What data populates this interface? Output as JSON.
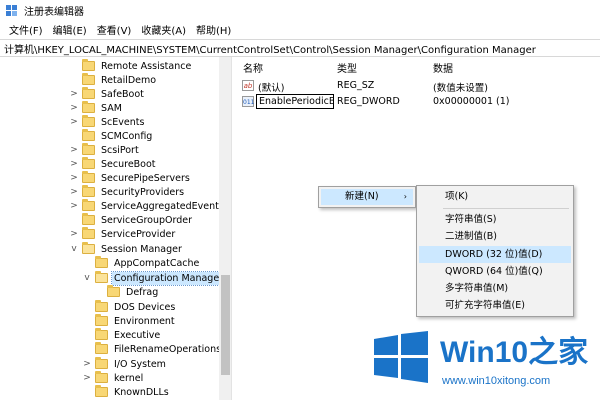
{
  "window": {
    "title": "注册表编辑器",
    "brand_color": "#3a7fd5"
  },
  "menu": [
    "文件(F)",
    "编辑(E)",
    "查看(V)",
    "收藏夹(A)",
    "帮助(H)"
  ],
  "address": "计算机\\HKEY_LOCAL_MACHINE\\SYSTEM\\CurrentControlSet\\Control\\Session Manager\\Configuration Manager",
  "tree": [
    {
      "label": "Remote Assistance",
      "expander": ""
    },
    {
      "label": "RetailDemo",
      "expander": ""
    },
    {
      "label": "SafeBoot",
      "expander": ">"
    },
    {
      "label": "SAM",
      "expander": ">"
    },
    {
      "label": "ScEvents",
      "expander": ">"
    },
    {
      "label": "SCMConfig",
      "expander": ""
    },
    {
      "label": "ScsiPort",
      "expander": ">"
    },
    {
      "label": "SecureBoot",
      "expander": ">"
    },
    {
      "label": "SecurePipeServers",
      "expander": ">"
    },
    {
      "label": "SecurityProviders",
      "expander": ">"
    },
    {
      "label": "ServiceAggregatedEvents",
      "expander": ">"
    },
    {
      "label": "ServiceGroupOrder",
      "expander": ""
    },
    {
      "label": "ServiceProvider",
      "expander": ">"
    },
    {
      "label": "Session Manager",
      "expander": "v"
    },
    {
      "label": "AppCompatCache",
      "expander": ""
    },
    {
      "label": "Configuration Manager",
      "expander": "v"
    },
    {
      "label": "Defrag",
      "expander": ""
    },
    {
      "label": "DOS Devices",
      "expander": ""
    },
    {
      "label": "Environment",
      "expander": ""
    },
    {
      "label": "Executive",
      "expander": ""
    },
    {
      "label": "FileRenameOperations",
      "expander": ""
    },
    {
      "label": "I/O System",
      "expander": ">"
    },
    {
      "label": "kernel",
      "expander": ">"
    },
    {
      "label": "KnownDLLs",
      "expander": ""
    }
  ],
  "list": {
    "headers": {
      "name": "名称",
      "type": "类型",
      "data": "数据"
    },
    "rows": [
      {
        "icon": "ab",
        "name": "(默认)",
        "type": "REG_SZ",
        "data": "(数值未设置)"
      },
      {
        "icon": "011",
        "name": "EnablePeriodicB...",
        "type": "REG_DWORD",
        "data": "0x00000001 (1)"
      }
    ]
  },
  "context_menu": {
    "new_label": "新建(N)",
    "arrow": "›"
  },
  "submenu": [
    "项(K)",
    "字符串值(S)",
    "二进制值(B)",
    "DWORD (32 位)值(D)",
    "QWORD (64 位)值(Q)",
    "多字符串值(M)",
    "可扩充字符串值(E)"
  ],
  "highlight_color": "#cce8ff",
  "watermark": {
    "title_prefix": "Win10",
    "title_suffix": "之家",
    "url": "www.win10xitong.com",
    "color": "#1a73c8"
  }
}
